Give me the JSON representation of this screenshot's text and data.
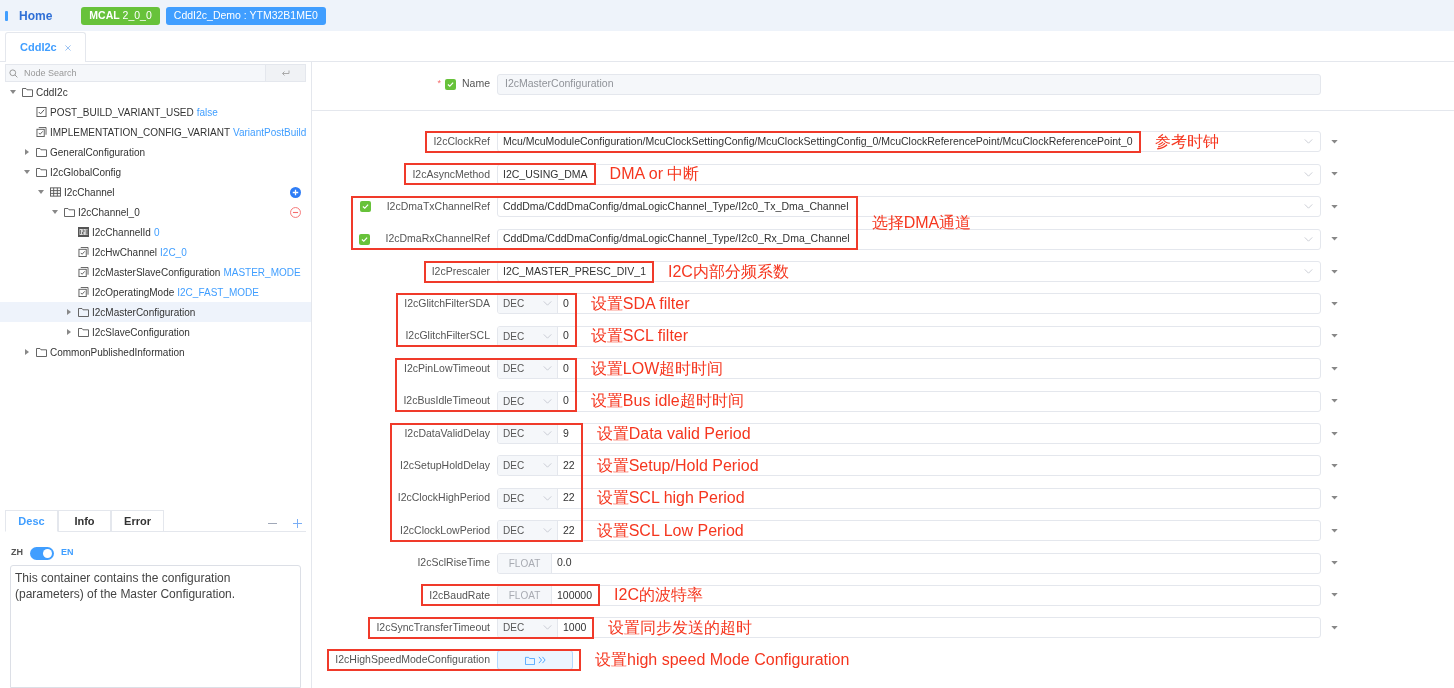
{
  "header": {
    "home": "Home",
    "badges": [
      {
        "text": "**MCAL** 2_0_0",
        "color": "#67c23a"
      },
      {
        "text": "CddI2c_Demo : YTM32B1ME0",
        "color": "#409eff"
      }
    ]
  },
  "tabs": [
    {
      "label": "CddI2c",
      "selected": true
    }
  ],
  "search": {
    "placeholder": "Node Search"
  },
  "tree": [
    {
      "label": "CddI2c",
      "kind": "container",
      "expanded": true,
      "selected": false,
      "children": [
        {
          "label": "POST_BUILD_VARIANT_USED",
          "value": "false",
          "kind": "boolean",
          "selected": false
        },
        {
          "label": "IMPLEMENTATION_CONFIG_VARIANT",
          "value": "VariantPostBuild",
          "kind": "enum",
          "selected": false
        },
        {
          "label": "GeneralConfiguration",
          "kind": "container",
          "expanded": false,
          "selected": false
        },
        {
          "label": "I2cGlobalConfig",
          "kind": "container",
          "expanded": true,
          "selected": false,
          "children": [
            {
              "label": "I2cChannel",
              "kind": "list",
              "expanded": true,
              "selected": false,
              "add_button": true,
              "children": [
                {
                  "label": "I2cChannel_0",
                  "kind": "container",
                  "expanded": true,
                  "selected": false,
                  "remove_button": true,
                  "children": [
                    {
                      "label": "I2cChannelId",
                      "value": "0",
                      "kind": "integer",
                      "selected": false
                    },
                    {
                      "label": "I2cHwChannel",
                      "value": "I2C_0",
                      "kind": "enum",
                      "selected": false
                    },
                    {
                      "label": "I2cMasterSlaveConfiguration",
                      "value": "MASTER_MODE",
                      "kind": "enum",
                      "selected": false
                    },
                    {
                      "label": "I2cOperatingMode",
                      "value": "I2C_FAST_MODE",
                      "kind": "enum",
                      "selected": false
                    },
                    {
                      "label": "I2cMasterConfiguration",
                      "kind": "container",
                      "expanded": false,
                      "selected": true
                    },
                    {
                      "label": "I2cSlaveConfiguration",
                      "kind": "container",
                      "expanded": false,
                      "selected": false
                    }
                  ]
                }
              ]
            }
          ]
        },
        {
          "label": "CommonPublishedInformation",
          "kind": "container",
          "expanded": false,
          "selected": false
        }
      ]
    }
  ],
  "bottom_tabs": [
    {
      "label": "Desc",
      "selected": true
    },
    {
      "label": "Info",
      "selected": false
    },
    {
      "label": "Error",
      "selected": false
    }
  ],
  "language_toggle": {
    "left": "ZH",
    "right": "EN",
    "on": true
  },
  "description": "This container contains the configuration (parameters) of the Master Configuration.",
  "name_field": {
    "required_mark": "*",
    "checked": true,
    "label": "Name",
    "value": "I2cMasterConfiguration"
  },
  "groups": [
    {
      "boxed": true,
      "notes": [
        "参考时钟"
      ],
      "fields": [
        {
          "label": "I2cClockRef",
          "kind": "select",
          "value": "Mcu/McuModuleConfiguration/McuClockSettingConfig/McuClockSettingConfig_0/McuClockReferencePoint/McuClockReferencePoint_0"
        }
      ]
    },
    {
      "boxed": true,
      "notes": [
        "DMA or 中断"
      ],
      "fields": [
        {
          "label": "I2cAsyncMethod",
          "kind": "select",
          "value": "I2C_USING_DMA"
        }
      ]
    },
    {
      "boxed": true,
      "notes": [
        "选择DMA通道"
      ],
      "fields": [
        {
          "label": "I2cDmaTxChannelRef",
          "kind": "select",
          "checked": true,
          "value": "CddDma/CddDmaConfig/dmaLogicChannel_Type/I2c0_Tx_Dma_Channel"
        },
        {
          "label": "I2cDmaRxChannelRef",
          "kind": "select",
          "checked": true,
          "value": "CddDma/CddDmaConfig/dmaLogicChannel_Type/I2c0_Rx_Dma_Channel"
        }
      ]
    },
    {
      "boxed": true,
      "notes": [
        "I2C内部分频系数"
      ],
      "fields": [
        {
          "label": "I2cPrescaler",
          "kind": "select",
          "value": "I2C_MASTER_PRESC_DIV_1"
        }
      ]
    },
    {
      "boxed": true,
      "notes": [
        "设置SDA filter",
        "设置SCL filter"
      ],
      "fields": [
        {
          "label": "I2cGlitchFilterSDA",
          "kind": "number",
          "format": "DEC",
          "value": "0"
        },
        {
          "label": "I2cGlitchFilterSCL",
          "kind": "number",
          "format": "DEC",
          "value": "0"
        }
      ]
    },
    {
      "boxed": true,
      "notes": [
        "设置LOW超时时间",
        "设置Bus idle超时时间"
      ],
      "fields": [
        {
          "label": "I2cPinLowTimeout",
          "kind": "number",
          "format": "DEC",
          "value": "0"
        },
        {
          "label": "I2cBusIdleTimeout",
          "kind": "number",
          "format": "DEC",
          "value": "0"
        }
      ]
    },
    {
      "boxed": true,
      "notes": [
        "设置Data valid Period",
        "设置Setup/Hold Period",
        "设置SCL high Period",
        "设置SCL Low Period"
      ],
      "fields": [
        {
          "label": "I2cDataValidDelay",
          "kind": "number",
          "format": "DEC",
          "value": "9"
        },
        {
          "label": "I2cSetupHoldDelay",
          "kind": "number",
          "format": "DEC",
          "value": "22"
        },
        {
          "label": "I2cClockHighPeriod",
          "kind": "number",
          "format": "DEC",
          "value": "22"
        },
        {
          "label": "I2cClockLowPeriod",
          "kind": "number",
          "format": "DEC",
          "value": "22"
        }
      ]
    },
    {
      "boxed": false,
      "fields": [
        {
          "label": "I2cSclRiseTime",
          "kind": "float",
          "format": "FLOAT",
          "value": "0.0"
        }
      ]
    },
    {
      "boxed": true,
      "notes": [
        "I2C的波特率"
      ],
      "fields": [
        {
          "label": "I2cBaudRate",
          "kind": "float",
          "format": "FLOAT",
          "value": "100000"
        }
      ]
    },
    {
      "boxed": true,
      "notes": [
        "设置同步发送的超时"
      ],
      "fields": [
        {
          "label": "I2cSyncTransferTimeout",
          "kind": "number",
          "format": "DEC",
          "value": "1000"
        }
      ]
    },
    {
      "boxed": true,
      "notes": [
        "设置high speed Mode Configuration"
      ],
      "fields": [
        {
          "label": "I2cHighSpeedModeConfiguration",
          "kind": "container"
        }
      ]
    }
  ]
}
